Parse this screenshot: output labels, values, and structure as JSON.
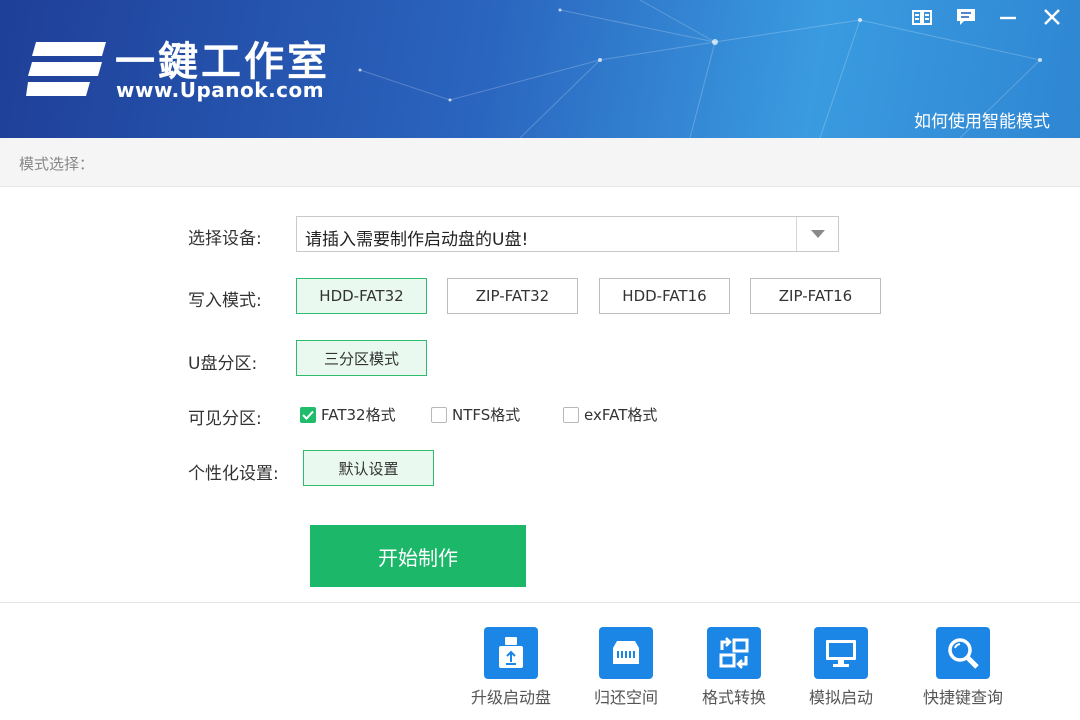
{
  "header": {
    "brand_title": "一鍵工作室",
    "brand_url": "www.Upanok.com",
    "help_link": "如何使用智能模式"
  },
  "mode_bar": {
    "label": "模式选择："
  },
  "form": {
    "device": {
      "label": "选择设备:",
      "selected": "请插入需要制作启动盘的U盘!"
    },
    "write_mode": {
      "label": "写入模式:",
      "options": [
        "HDD-FAT32",
        "ZIP-FAT32",
        "HDD-FAT16",
        "ZIP-FAT16"
      ],
      "selected": "HDD-FAT32"
    },
    "partition": {
      "label": "U盘分区:",
      "button": "三分区模式"
    },
    "visible_partition": {
      "label": "可见分区:",
      "options": [
        {
          "label": "FAT32格式",
          "checked": true
        },
        {
          "label": "NTFS格式",
          "checked": false
        },
        {
          "label": "exFAT格式",
          "checked": false
        }
      ]
    },
    "personalize": {
      "label": "个性化设置:",
      "button": "默认设置"
    },
    "start_button": "开始制作"
  },
  "tools": [
    {
      "label": "升级启动盘",
      "icon": "usb-upgrade-icon"
    },
    {
      "label": "归还空间",
      "icon": "memory-icon"
    },
    {
      "label": "格式转换",
      "icon": "format-convert-icon"
    },
    {
      "label": "模拟启动",
      "icon": "monitor-icon"
    },
    {
      "label": "快捷键查询",
      "icon": "search-icon"
    }
  ],
  "colors": {
    "accent_green": "#1db76a",
    "tool_blue": "#1b86e5",
    "header_blue": "#2a65bf"
  }
}
